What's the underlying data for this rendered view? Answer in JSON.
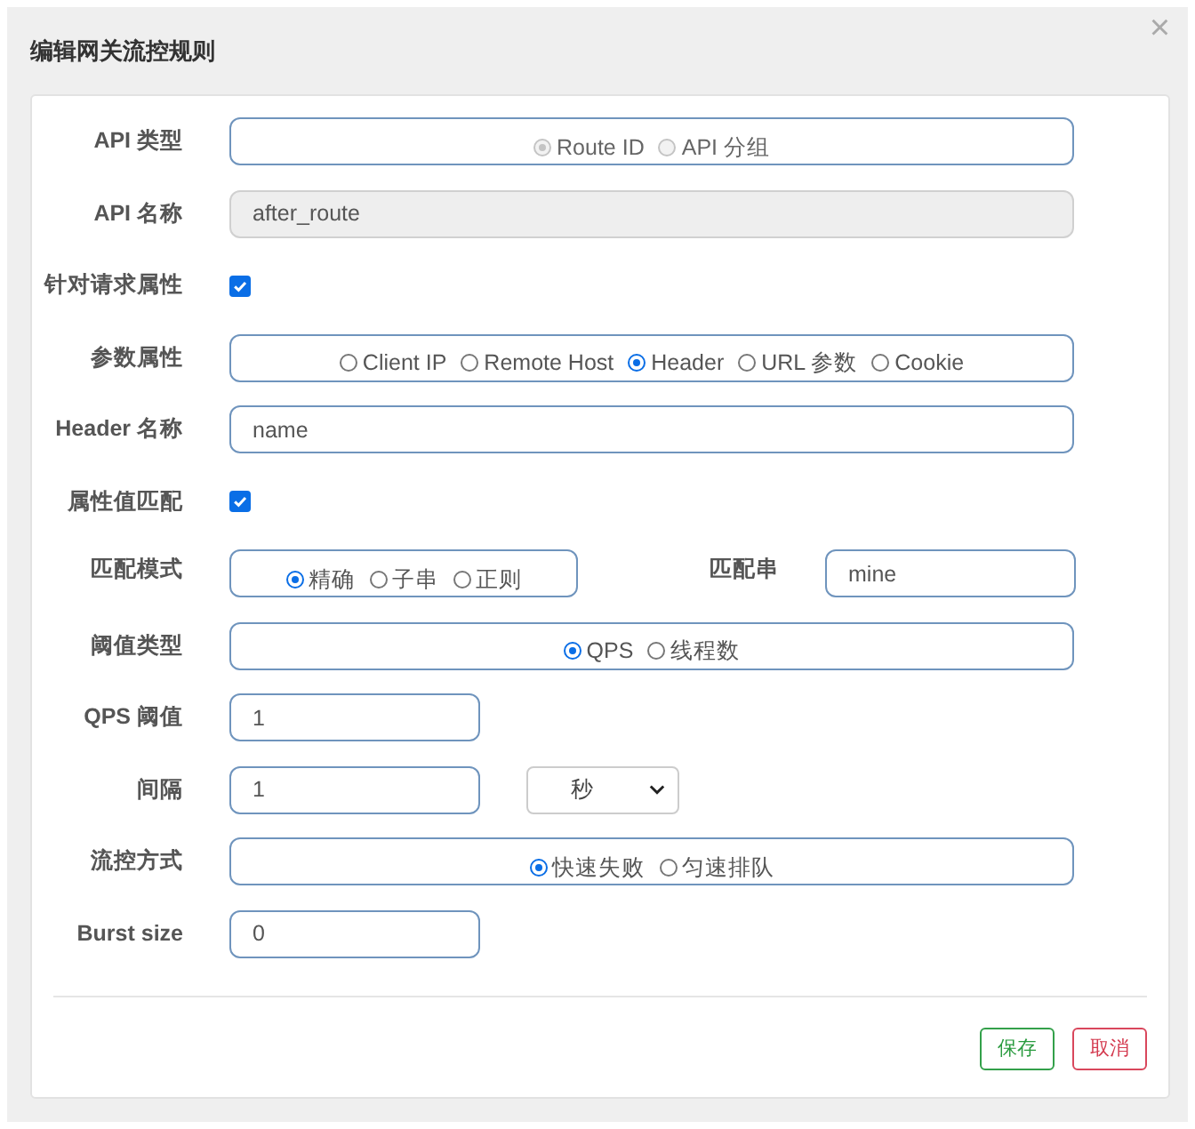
{
  "dialog": {
    "title": "编辑网关流控规则",
    "close": "×"
  },
  "fields": [
    {
      "kind": "radio",
      "label": "API 类型",
      "disabled": true,
      "options": [
        {
          "label": "Route ID",
          "selected": true
        },
        {
          "label": "API 分组",
          "selected": false
        }
      ]
    },
    {
      "kind": "text",
      "label": "API 名称",
      "value": "after_route",
      "disabled": true
    },
    {
      "kind": "checkbox",
      "label": "针对请求属性",
      "checked": true
    },
    {
      "kind": "radio",
      "label": "参数属性",
      "disabled": false,
      "options": [
        {
          "label": "Client IP",
          "selected": false
        },
        {
          "label": "Remote Host",
          "selected": false
        },
        {
          "label": "Header",
          "selected": true
        },
        {
          "label": "URL 参数",
          "selected": false
        },
        {
          "label": "Cookie",
          "selected": false
        }
      ]
    },
    {
      "kind": "text",
      "label": "Header 名称",
      "value": "name",
      "disabled": false
    },
    {
      "kind": "checkbox",
      "label": "属性值匹配",
      "checked": true
    },
    {
      "kind": "match",
      "label": "匹配模式",
      "options": [
        {
          "label": "精确",
          "selected": true
        },
        {
          "label": "子串",
          "selected": false
        },
        {
          "label": "正则",
          "selected": false
        }
      ],
      "pair_label": "匹配串",
      "pair_value": "mine"
    },
    {
      "kind": "radio",
      "label": "阈值类型",
      "disabled": false,
      "options": [
        {
          "label": "QPS",
          "selected": true
        },
        {
          "label": "线程数",
          "selected": false
        }
      ]
    },
    {
      "kind": "short_text",
      "label": "QPS 阈值",
      "value": "1"
    },
    {
      "kind": "interval",
      "label": "间隔",
      "value": "1",
      "unit": "秒"
    },
    {
      "kind": "radio",
      "label": "流控方式",
      "disabled": false,
      "options": [
        {
          "label": "快速失败",
          "selected": true
        },
        {
          "label": "匀速排队",
          "selected": false
        }
      ]
    },
    {
      "kind": "short_text",
      "label": "Burst size",
      "value": "0"
    }
  ],
  "buttons": [
    {
      "label": "保存",
      "kind": "save"
    },
    {
      "label": "取消",
      "kind": "cancel"
    }
  ]
}
